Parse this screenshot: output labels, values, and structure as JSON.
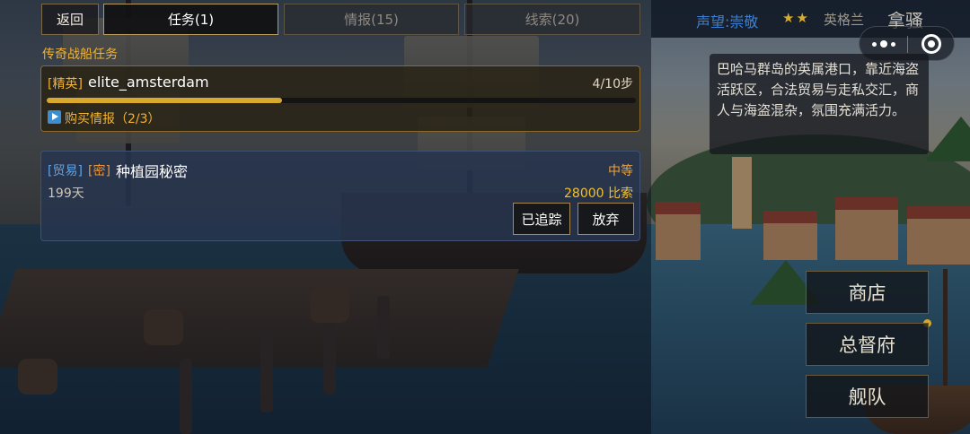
{
  "tabs": {
    "back": "返回",
    "missions": "任务(1)",
    "intel": "情报(15)",
    "clues": "线索(20)"
  },
  "legend_section": {
    "title": "传奇战船任务",
    "card": {
      "tag": "[精英]",
      "name": "elite_amsterdam",
      "steps": "4/10步",
      "progress_fraction": 0.4,
      "hint": "购买情报（2/3）"
    }
  },
  "task": {
    "tag_trade": "[贸易]",
    "tag_secret": "[密]",
    "name": "种植园秘密",
    "difficulty": "中等",
    "days": "199天",
    "reward": "28000 比索",
    "tracked_label": "已追踪",
    "abandon_label": "放弃"
  },
  "status": {
    "reputation": "声望:崇敬",
    "stars": "★★",
    "nation": "英格兰",
    "location": "拿骚"
  },
  "description": "巴哈马群岛的英属港口，靠近海盗活跃区，合法贸易与走私交汇，商人与海盗混杂，氛围充满活力。",
  "side_menu": {
    "shop": "商店",
    "governor": "总督府",
    "fleet": "舰队"
  },
  "icons": {
    "hint": "play-icon",
    "capsule_menu": "more-dots-icon",
    "capsule_close": "target-icon"
  },
  "colors": {
    "gold": "#f0b332",
    "trade_blue": "#5ea4e6",
    "reputation_blue": "#3f7fd0"
  }
}
